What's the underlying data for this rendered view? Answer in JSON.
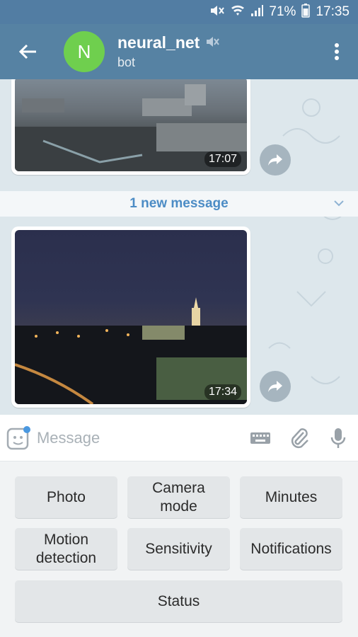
{
  "status_bar": {
    "battery": "71%",
    "time": "17:35"
  },
  "header": {
    "back_icon": "arrow-left-icon",
    "avatar_letter": "N",
    "avatar_color": "#6fcf4e",
    "title": "neural_net",
    "subtitle": "bot",
    "muted_icon": "mute-icon",
    "menu_icon": "more-vert-icon"
  },
  "messages": [
    {
      "type": "photo",
      "time": "17:07"
    },
    {
      "type": "photo",
      "time": "17:34"
    }
  ],
  "new_messages_label": "1 new message",
  "input": {
    "placeholder": "Message"
  },
  "keyboard": {
    "photo": "Photo",
    "camera_mode": "Camera\nmode",
    "minutes": "Minutes",
    "motion_detection": "Motion\ndetection",
    "sensitivity": "Sensitivity",
    "notifications": "Notifications",
    "status": "Status"
  },
  "colors": {
    "header": "#5682a3",
    "status_bar": "#527da3",
    "link": "#4c8cc5"
  }
}
